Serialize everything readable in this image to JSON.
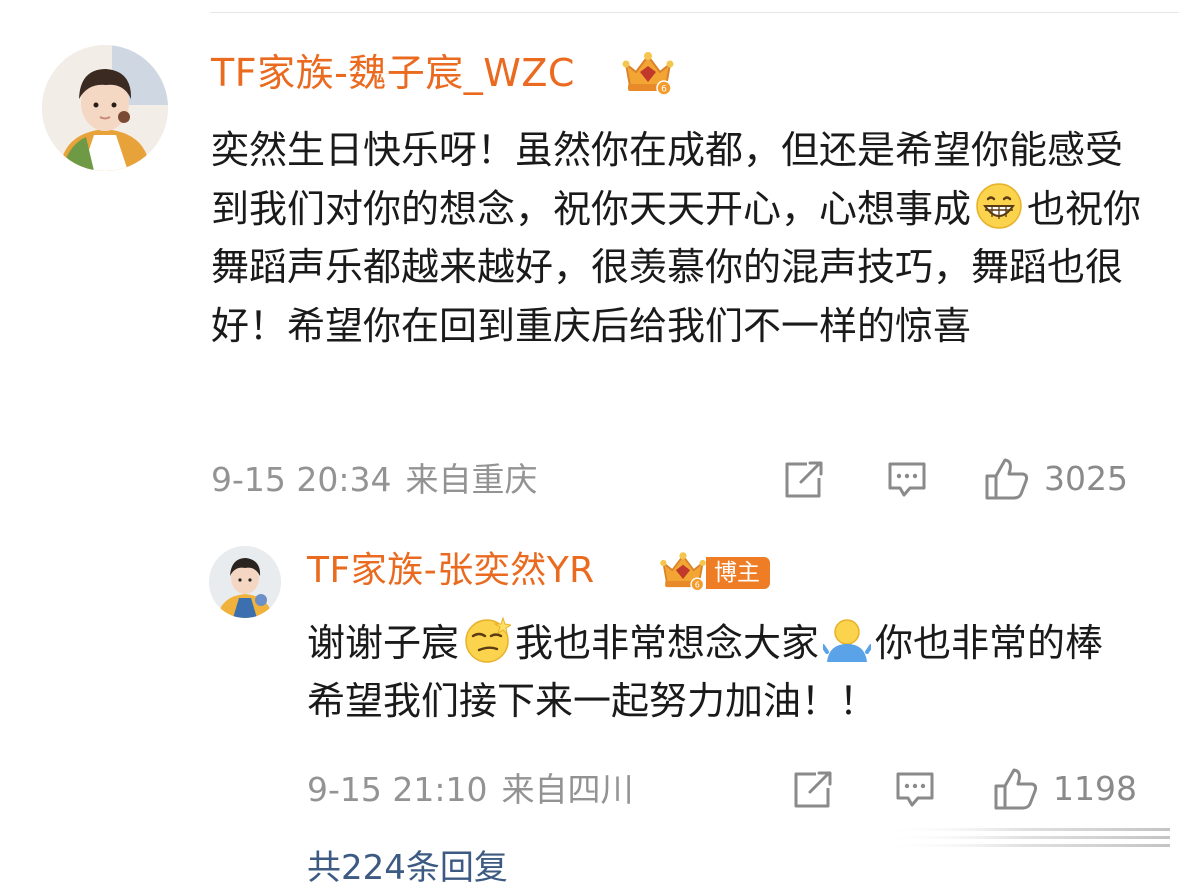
{
  "comment": {
    "username": "TF家族-魏子宸_WZC",
    "text_part1": "奕然生日快乐呀！虽然你在成都，但还是希望你能感受到我们对你的想念，祝你天天开心，心想事成",
    "text_emoji": "grinning-face-emoji",
    "text_part2": "也祝你舞蹈声乐都越来越好，很羡慕你的混声技巧，舞蹈也很好！希望你在回到重庆后给我们不一样的惊喜",
    "time": "9-15 20:34",
    "location": "来自重庆",
    "likes": "3025",
    "badge_icon": "crown-badge-icon"
  },
  "reply": {
    "username": "TF家族-张奕然YR",
    "blogger_tag": "博主",
    "text_part1": "谢谢子宸",
    "text_emoji1": "smirking-star-face-emoji",
    "text_part2": "我也非常想念大家",
    "text_emoji2": "yellow-person-emoji",
    "text_part3": "你也非常的棒 希望我们接下来一起努力加油！！",
    "time": "9-15 21:10",
    "location": "来自四川",
    "likes": "1198",
    "badge_icon": "crown-badge-icon"
  },
  "more_replies": "共224条回复",
  "colors": {
    "username": "#ea6a1f",
    "text": "#1a1a1a",
    "meta": "#939393",
    "blogger_tag": "#ef7d26"
  }
}
